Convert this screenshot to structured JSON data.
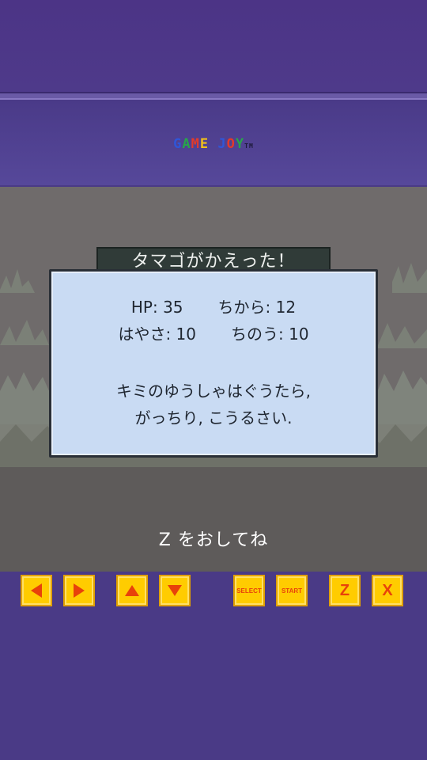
{
  "brand": {
    "letters": [
      {
        "ch": "G",
        "color": "#2f56d8"
      },
      {
        "ch": "A",
        "color": "#27a64a"
      },
      {
        "ch": "M",
        "color": "#e23a2a"
      },
      {
        "ch": "E",
        "color": "#f2c01a"
      },
      {
        "ch": " ",
        "color": "#000000"
      },
      {
        "ch": "J",
        "color": "#2f56d8"
      },
      {
        "ch": "O",
        "color": "#e23a2a"
      },
      {
        "ch": "Y",
        "color": "#27a64a"
      }
    ],
    "tm": "TM"
  },
  "dialog": {
    "title": "タマゴがかえった！",
    "stats": {
      "hp": "HP: 35",
      "power": "ちから: 12",
      "speed": "はやさ: 10",
      "intelligence": "ちのう: 10"
    },
    "message_line1": "キミのゆうしゃはぐうたら,",
    "message_line2": "がっちり, こうるさい."
  },
  "prompt": "Z をおしてね",
  "controls": {
    "left": "left-arrow-icon",
    "right": "right-arrow-icon",
    "up": "up-arrow-icon",
    "down": "down-arrow-icon",
    "select": "SELECT",
    "start": "START",
    "z": "Z",
    "x": "X"
  },
  "colors": {
    "button_fill": "#ffcc00",
    "button_glyph": "#e8420a",
    "dialog_fill": "#c9dbf3"
  }
}
